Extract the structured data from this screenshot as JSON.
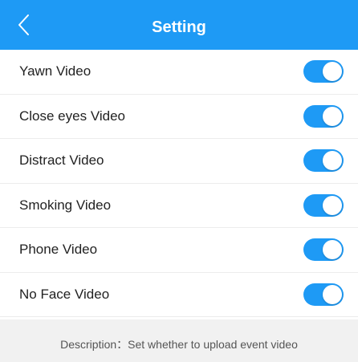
{
  "header": {
    "title": "Setting",
    "back_icon": "chevron-left-icon"
  },
  "settings": [
    {
      "label": "Yawn Video",
      "enabled": true
    },
    {
      "label": "Close eyes Video",
      "enabled": true
    },
    {
      "label": "Distract Video",
      "enabled": true
    },
    {
      "label": "Smoking Video",
      "enabled": true
    },
    {
      "label": "Phone Video",
      "enabled": true
    },
    {
      "label": "No Face Video",
      "enabled": true
    }
  ],
  "description": "Description：Set whether to upload event video",
  "colors": {
    "accent": "#1e9af5",
    "background": "#ffffff",
    "description_bg": "#f1f1f1"
  }
}
